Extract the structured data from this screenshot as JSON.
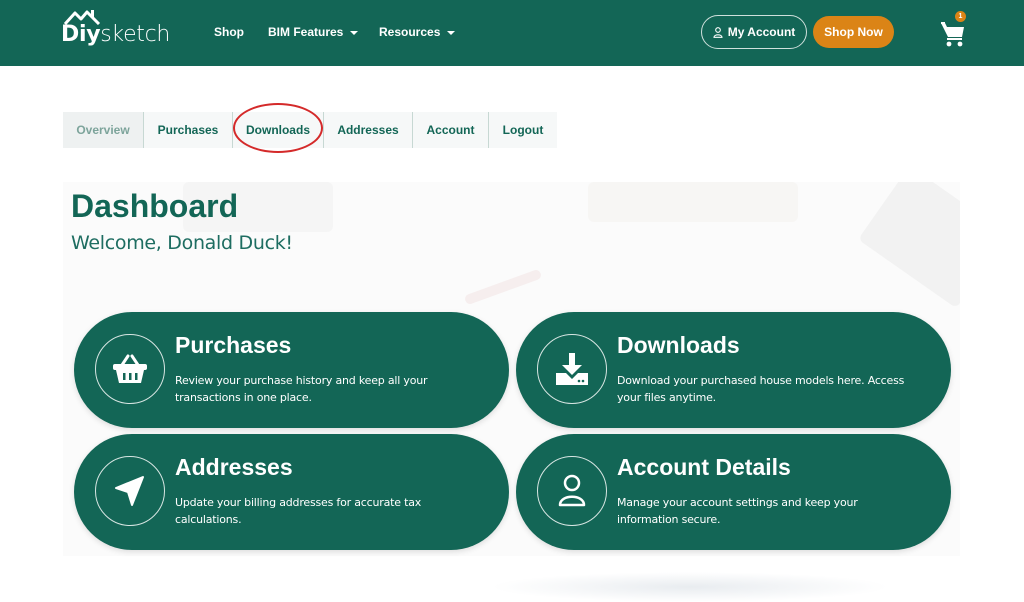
{
  "header": {
    "logo": {
      "bold": "Diy",
      "light": "sketch"
    },
    "nav": [
      {
        "label": "Shop",
        "has_dropdown": false
      },
      {
        "label": "BIM Features",
        "has_dropdown": true
      },
      {
        "label": "Resources",
        "has_dropdown": true
      }
    ],
    "my_account_label": "My Account",
    "shop_now_label": "Shop Now",
    "cart_count": "1",
    "colors": {
      "brand": "#136656",
      "accent": "#db8416"
    }
  },
  "tabs": [
    {
      "label": "Overview",
      "active": true
    },
    {
      "label": "Purchases",
      "active": false
    },
    {
      "label": "Downloads",
      "active": false,
      "highlighted": true
    },
    {
      "label": "Addresses",
      "active": false
    },
    {
      "label": "Account",
      "active": false
    },
    {
      "label": "Logout",
      "active": false
    }
  ],
  "dashboard": {
    "title": "Dashboard",
    "welcome": "Welcome, Donald Duck!"
  },
  "cards": [
    {
      "icon": "basket-icon",
      "title": "Purchases",
      "description": "Review your purchase history and keep all your transactions in one place."
    },
    {
      "icon": "download-icon",
      "title": "Downloads",
      "description": "Download your purchased house models here. Access your files anytime."
    },
    {
      "icon": "location-arrow-icon",
      "title": "Addresses",
      "description": "Update your billing addresses for accurate tax calculations."
    },
    {
      "icon": "user-icon",
      "title": "Account Details",
      "description": "Manage your account settings and keep your information secure."
    }
  ]
}
